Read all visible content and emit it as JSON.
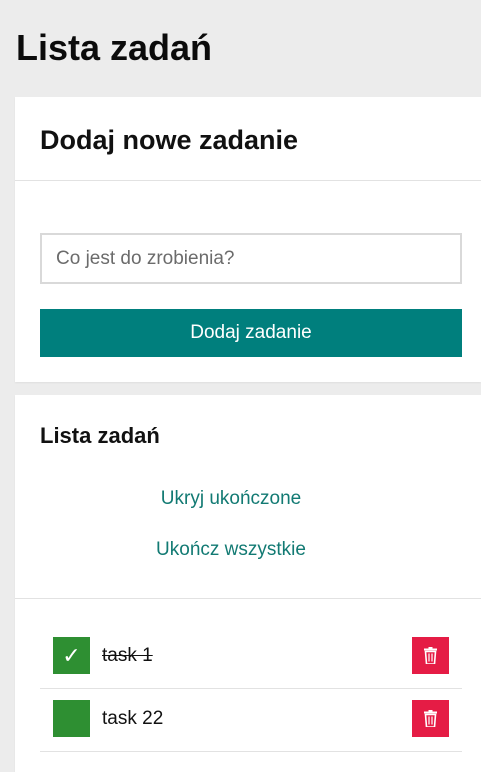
{
  "page": {
    "title": "Lista zadań"
  },
  "add_card": {
    "title": "Dodaj nowe zadanie",
    "input_value": "",
    "input_placeholder": "Co jest do zrobienia?",
    "button_label": "Dodaj zadanie"
  },
  "list_card": {
    "title": "Lista zadań",
    "hide_completed_label": "Ukryj ukończone",
    "complete_all_label": "Ukończ wszystkie",
    "tasks": [
      {
        "label": "task 1",
        "completed": true,
        "check_glyph": "✓"
      },
      {
        "label": "task 22",
        "completed": false,
        "check_glyph": ""
      }
    ]
  },
  "icons": {
    "check": "check-icon",
    "delete": "trash-icon"
  },
  "colors": {
    "accent": "#007f7d",
    "link": "#127a73",
    "complete": "#2e8f32",
    "delete": "#e51c45",
    "background": "#ececec"
  }
}
